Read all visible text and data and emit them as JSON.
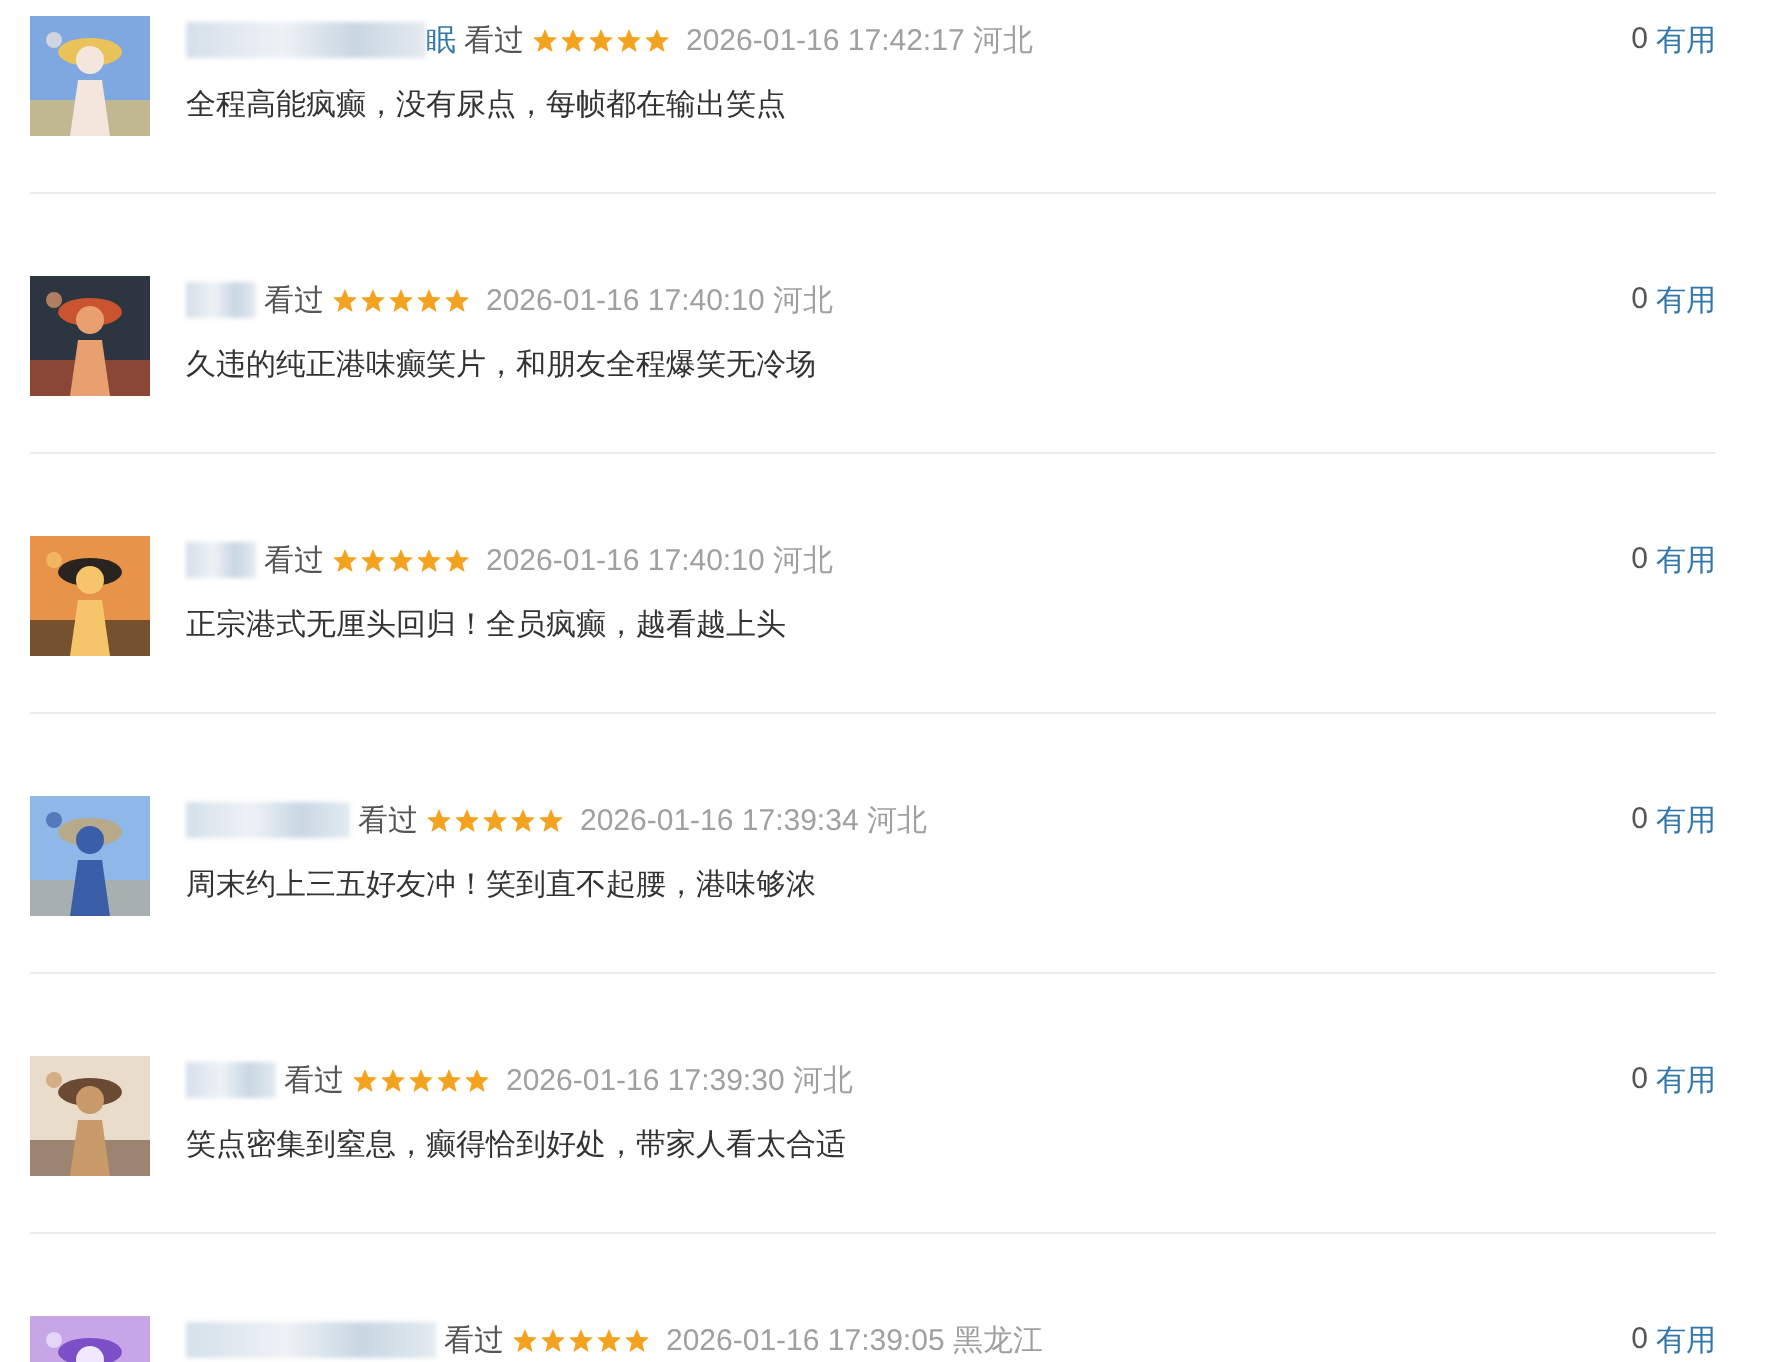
{
  "comments": [
    {
      "name_tail": "眠",
      "status": "看过",
      "stars": 5,
      "time": "2026-01-16 17:42:17",
      "location": "河北",
      "text": "全程高能疯癫，没有尿点，每帧都在输出笑点",
      "useful_count": "0",
      "useful_label": "有用"
    },
    {
      "status": "看过",
      "stars": 5,
      "time": "2026-01-16 17:40:10",
      "location": "河北",
      "text": "久违的纯正港味癫笑片，和朋友全程爆笑无冷场",
      "useful_count": "0",
      "useful_label": "有用"
    },
    {
      "status": "看过",
      "stars": 5,
      "time": "2026-01-16 17:40:10",
      "location": "河北",
      "text": "正宗港式无厘头回归！全员疯癫，越看越上头",
      "useful_count": "0",
      "useful_label": "有用"
    },
    {
      "status": "看过",
      "stars": 5,
      "time": "2026-01-16 17:39:34",
      "location": "河北",
      "text": "周末约上三五好友冲！笑到直不起腰，港味够浓",
      "useful_count": "0",
      "useful_label": "有用"
    },
    {
      "status": "看过",
      "stars": 5,
      "time": "2026-01-16 17:39:30",
      "location": "河北",
      "text": "笑点密集到窒息，癫得恰到好处，带家人看太合适",
      "useful_count": "0",
      "useful_label": "有用"
    },
    {
      "status": "看过",
      "stars": 5,
      "time": "2026-01-16 17:39:05",
      "location": "黑龙江",
      "useful_count": "0",
      "useful_label": "有用"
    }
  ]
}
